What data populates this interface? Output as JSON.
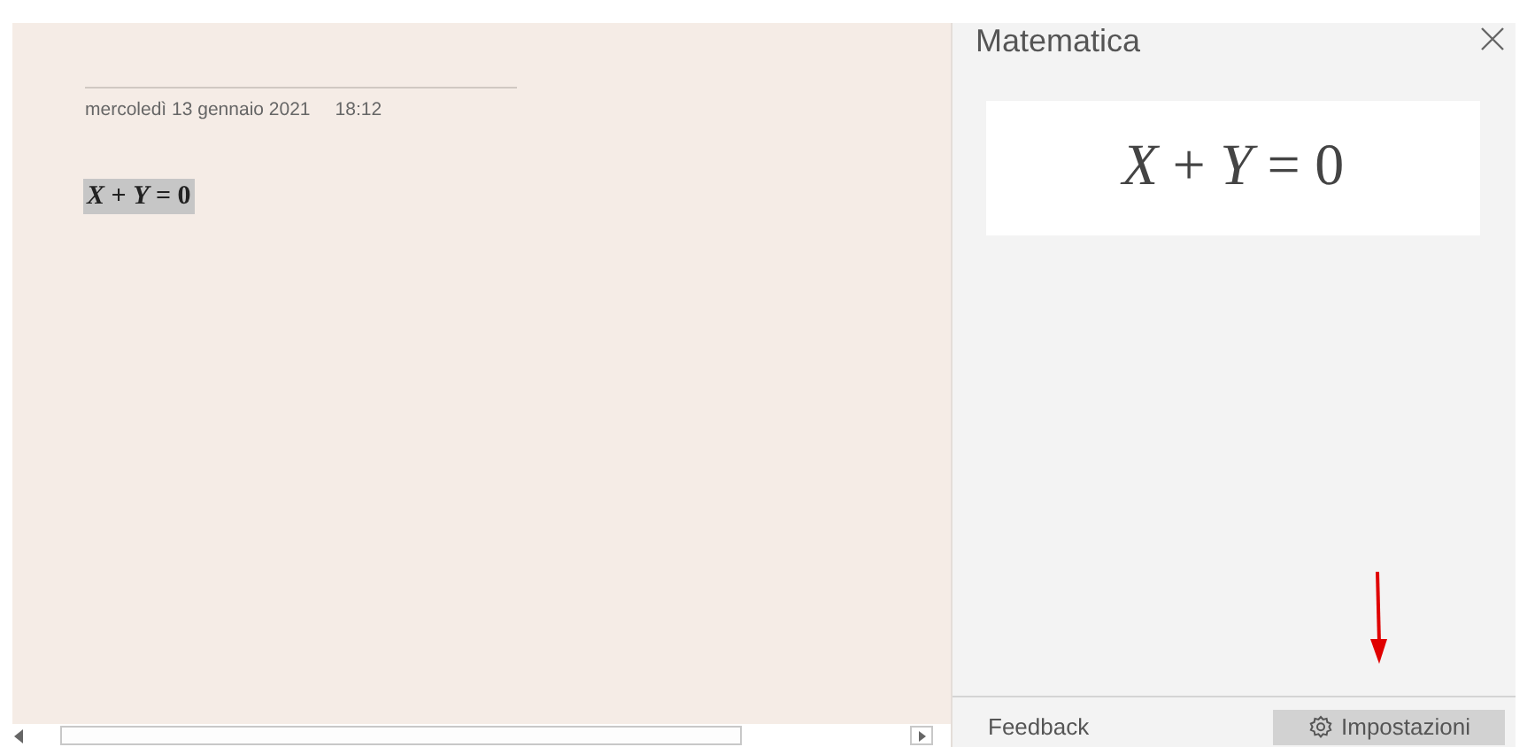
{
  "note": {
    "date": "mercoledì 13 gennaio 2021",
    "time": "18:12",
    "equation": "*X* + *Y* = 0"
  },
  "math_pane": {
    "title": "Matematica",
    "equation": "*X* + *Y* = 0",
    "feedback": "Feedback",
    "settings_button": "Impostazioni"
  }
}
